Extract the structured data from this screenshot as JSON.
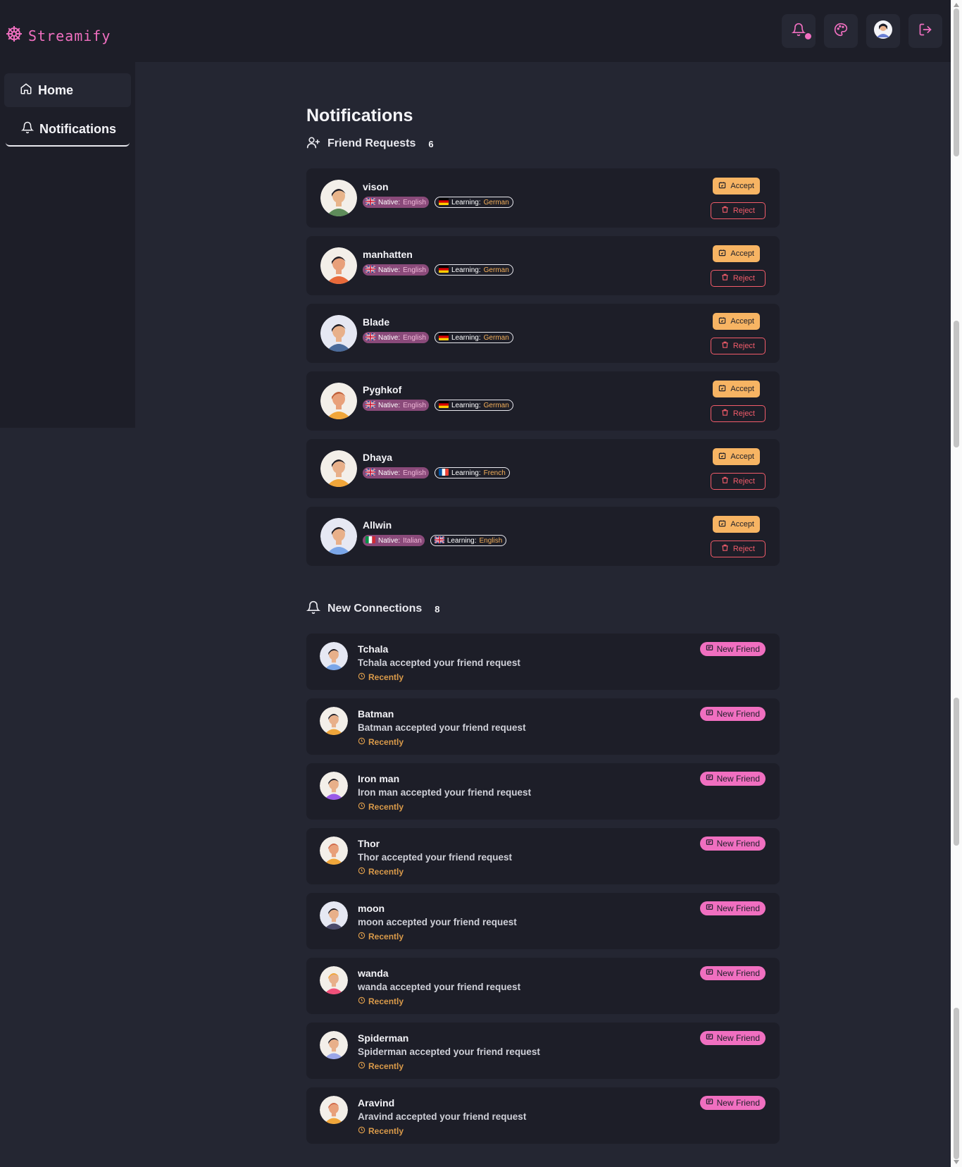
{
  "brand": {
    "name": "Streamify",
    "icon": "ship-wheel-icon"
  },
  "topbar": {
    "icons": [
      "bell-icon",
      "palette-icon",
      "avatar",
      "logout-icon"
    ]
  },
  "sidebar": {
    "items": [
      {
        "label": "Home",
        "icon": "home-icon"
      },
      {
        "label": "Notifications",
        "icon": "bell-icon"
      }
    ]
  },
  "page": {
    "title": "Notifications"
  },
  "friend_requests": {
    "heading": "Friend Requests",
    "count": "6",
    "native_prefix": "Native:",
    "learning_prefix": "Learning:",
    "accept_label": "Accept",
    "reject_label": "Reject",
    "items": [
      {
        "name": "vison",
        "native": "English",
        "learning": "German"
      },
      {
        "name": "manhatten",
        "native": "English",
        "learning": "German"
      },
      {
        "name": "Blade",
        "native": "English",
        "learning": "German"
      },
      {
        "name": "Pyghkof",
        "native": "English",
        "learning": "German"
      },
      {
        "name": "Dhaya",
        "native": "English",
        "learning": "French"
      },
      {
        "name": "Allwin",
        "native": "Italian",
        "learning": "English"
      }
    ]
  },
  "connections": {
    "heading": "New Connections",
    "count": "8",
    "badge_label": "New Friend",
    "time_label": "Recently",
    "items": [
      {
        "name": "Tchala",
        "message": "Tchala accepted your friend request"
      },
      {
        "name": "Batman",
        "message": "Batman accepted your friend request"
      },
      {
        "name": "Iron man",
        "message": "Iron man accepted your friend request"
      },
      {
        "name": "Thor",
        "message": "Thor accepted your friend request"
      },
      {
        "name": "moon",
        "message": "moon accepted your friend request"
      },
      {
        "name": "wanda",
        "message": "wanda accepted your friend request"
      },
      {
        "name": "Spiderman",
        "message": "Spiderman accepted your friend request"
      },
      {
        "name": "Aravind",
        "message": "Aravind accepted your friend request"
      }
    ]
  },
  "colors": {
    "accent": "#f06fc0",
    "accept": "#f7b463",
    "reject": "#f25c6a",
    "bg": "#242632",
    "card": "#1d1e28"
  }
}
